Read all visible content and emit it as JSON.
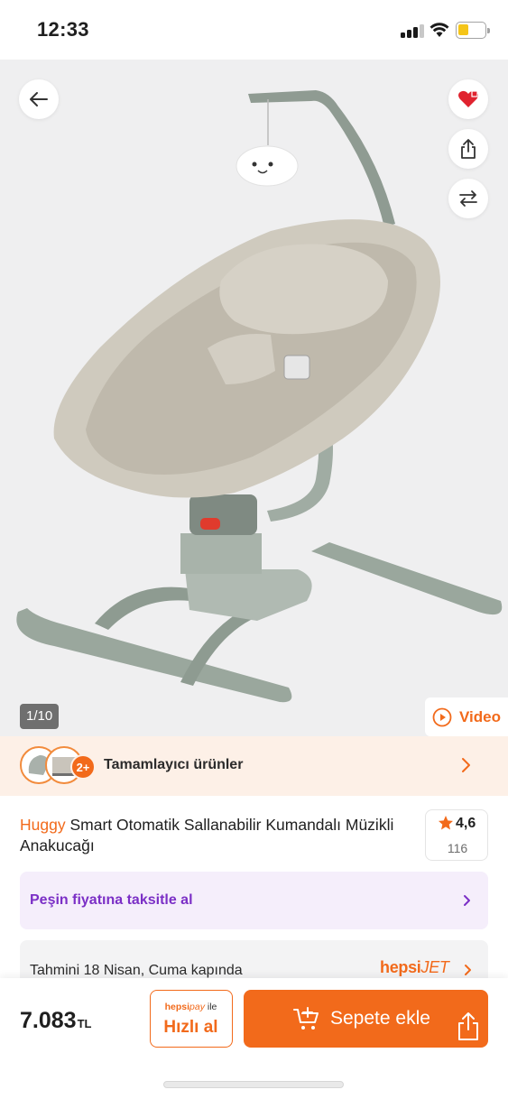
{
  "status_bar": {
    "time": "12:33",
    "icons": [
      "signal-icon",
      "wifi-icon",
      "battery-icon"
    ],
    "battery_color": "#f5c518"
  },
  "gallery": {
    "counter": "1/10",
    "video_label": "Video",
    "icons": [
      "back-arrow-icon",
      "heart-icon",
      "share-icon",
      "compare-icon",
      "play-icon"
    ]
  },
  "complementary": {
    "badge": "2+",
    "label": "Tamamlayıcı ürünler"
  },
  "product": {
    "brand": "Huggy",
    "title": "Smart Otomatik Sallanabilir Kumandalı Müzikli Anakucağı",
    "rating": "4,6",
    "review_count": "116"
  },
  "installment": {
    "label": "Peşin fiyatına taksitle al"
  },
  "delivery": {
    "label": "Tahmini 18 Nisan, Cuma kapında",
    "carrier_part1": "hepsi",
    "carrier_part2": "JET"
  },
  "bottom_bar": {
    "price": "7.083",
    "currency": "TL",
    "quick_buy_brand1": "hepsi",
    "quick_buy_brand2": "pay",
    "quick_buy_ile": " ile",
    "quick_buy_label": "Hızlı al",
    "add_to_cart_label": "Sepete ekle"
  },
  "colors": {
    "brand_orange": "#f26a1b",
    "installment_purple": "#7b2fc6",
    "installment_bg": "#f5eefb",
    "complementary_bg": "#fdf0e7"
  }
}
